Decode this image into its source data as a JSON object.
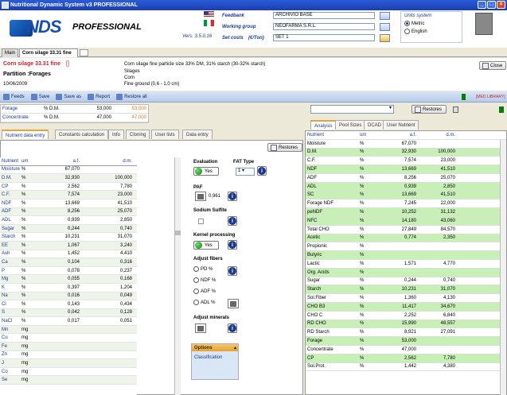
{
  "window": {
    "title": "Nutritional Dynamic System v3 PROFESSIONAL"
  },
  "header": {
    "logo_text": "NDS",
    "professional_label": "PROFESSIONAL",
    "version": "Vers. 3.5.0.16",
    "feedbank_label": "Feedbank",
    "feedbank_value": "ARCHIVIO BASE",
    "working_group_label": "Working group",
    "working_group_value": "NEOFARMA S.R.L.",
    "set_costs_label": "Set costs",
    "set_costs_unit": "(€/Ton)",
    "set_costs_value": "SET 1",
    "units_title": "Units system",
    "unit_metric": "Metric",
    "unit_english": "English",
    "selected_unit": "Metric"
  },
  "tabs": [
    {
      "label": "Main"
    },
    {
      "label": "Corn silage 33.31 fine",
      "active": true
    }
  ],
  "doc": {
    "title": "Corn silage 33.31 fine",
    "title_suffix": "[]",
    "partition": "Partition :Forages",
    "date": "10/06/2009",
    "desc1": "Corn silage fine particle size 33% DM, 31% starch (30-32% starch)",
    "desc2": "Silages",
    "desc3": "Corn",
    "desc4": "Fine ground (0,6 - 1,0 cm)",
    "close_label": "Close",
    "med_library": "[MED LIBRARY]"
  },
  "toolbar": {
    "feeds": "Feeds",
    "save": "Save",
    "save_as": "Save as",
    "report": "Report",
    "restore_all": "Restore all"
  },
  "forage_conc": [
    {
      "name": "Forage",
      "unit": "% D.M.",
      "v1": "53,000",
      "v2": "53,000"
    },
    {
      "name": "Concentrate",
      "unit": "% D.M.",
      "v1": "47,000",
      "v2": "47,000"
    }
  ],
  "left_tabs": [
    "Nutrient data entry",
    "Constants calculation",
    "Info",
    "Cloning",
    "User lists",
    "Data entry"
  ],
  "restores_label": "Restores",
  "nutrients_header": {
    "c1": "Nutrient",
    "c2": "um",
    "c3": "a.f.",
    "c4": "d.m."
  },
  "nutrients": [
    {
      "n": "Moisture",
      "u": "%",
      "a": "67,070",
      "d": ""
    },
    {
      "n": "D.M.",
      "u": "%",
      "a": "32,930",
      "d": "100,000"
    },
    {
      "n": "CP",
      "u": "%",
      "a": "2,562",
      "d": "7,780"
    },
    {
      "n": "C.F.",
      "u": "%",
      "a": "7,574",
      "d": "23,000"
    },
    {
      "n": "NDF",
      "u": "%",
      "a": "13,669",
      "d": "41,510"
    },
    {
      "n": "ADF",
      "u": "%",
      "a": "8,256",
      "d": "25,070"
    },
    {
      "n": "ADL",
      "u": "%",
      "a": "0,939",
      "d": "2,850"
    },
    {
      "n": "Sugar",
      "u": "%",
      "a": "0,244",
      "d": "0,740"
    },
    {
      "n": "Starch",
      "u": "%",
      "a": "10,231",
      "d": "31,070"
    },
    {
      "n": "EE",
      "u": "%",
      "a": "1,067",
      "d": "3,240"
    },
    {
      "n": "Ash",
      "u": "%",
      "a": "1,452",
      "d": "4,410"
    },
    {
      "n": "Ca",
      "u": "%",
      "a": "0,104",
      "d": "0,316"
    },
    {
      "n": "P",
      "u": "%",
      "a": "0,078",
      "d": "0,237"
    },
    {
      "n": "Mg",
      "u": "%",
      "a": "0,055",
      "d": "0,168"
    },
    {
      "n": "K",
      "u": "%",
      "a": "0,397",
      "d": "1,204"
    },
    {
      "n": "Na",
      "u": "%",
      "a": "0,016",
      "d": "0,049"
    },
    {
      "n": "Cl",
      "u": "%",
      "a": "0,143",
      "d": "0,434"
    },
    {
      "n": "S",
      "u": "%",
      "a": "0,042",
      "d": "0,128"
    },
    {
      "n": "NaCl",
      "u": "%",
      "a": "0,017",
      "d": "0,051"
    },
    {
      "n": "Mn",
      "u": "mg",
      "a": "",
      "d": ""
    },
    {
      "n": "Cu",
      "u": "mg",
      "a": "",
      "d": ""
    },
    {
      "n": "Fe",
      "u": "mg",
      "a": "",
      "d": ""
    },
    {
      "n": "Zn",
      "u": "mg",
      "a": "",
      "d": ""
    },
    {
      "n": "J",
      "u": "mg",
      "a": "",
      "d": ""
    },
    {
      "n": "Co",
      "u": "mg",
      "a": "",
      "d": ""
    },
    {
      "n": "Se",
      "u": "mg",
      "a": "",
      "d": ""
    }
  ],
  "controls": {
    "evaluation": "Evaluation",
    "evaluation_value": "Yes",
    "fat_type": "FAT Type",
    "fat_value": "1",
    "paf": "PAF",
    "paf_value": "0,961",
    "sodium_sulfite": "Sodium Sulfite",
    "kernel_processing": "Kernel processing",
    "kernel_value": "Yes",
    "adjust_fibers": "Adjust fibers",
    "fibers": [
      "PD %",
      "NDF %",
      "ADF %",
      "ADL %"
    ],
    "adjust_minerals": "Adjust minerals"
  },
  "options": {
    "title": "Options",
    "item": "Classification"
  },
  "right": {
    "restores_label": "Restores",
    "tabs": [
      "Analysis",
      "Pool Sizes",
      "DCAD",
      "User Nutrient"
    ],
    "header": {
      "n": "Nutrient",
      "u": "um",
      "a": "a.f.",
      "d": "d.m."
    },
    "rows": [
      {
        "n": "Moisture",
        "u": "%",
        "a": "67,070",
        "d": "",
        "g": false
      },
      {
        "n": "D.M.",
        "u": "%",
        "a": "32,930",
        "d": "100,000",
        "g": true
      },
      {
        "n": "C.F.",
        "u": "%",
        "a": "7,574",
        "d": "23,000",
        "g": false
      },
      {
        "n": "NDF",
        "u": "%",
        "a": "13,669",
        "d": "41,510",
        "g": true
      },
      {
        "n": "ADF",
        "u": "%",
        "a": "8,256",
        "d": "25,070",
        "g": false
      },
      {
        "n": "ADL",
        "u": "%",
        "a": "0,939",
        "d": "2,850",
        "g": true
      },
      {
        "n": "SC",
        "u": "%",
        "a": "13,669",
        "d": "41,510",
        "g": true
      },
      {
        "n": "Forage NDF",
        "u": "%",
        "a": "7,245",
        "d": "22,000",
        "g": false
      },
      {
        "n": "peNDF",
        "u": "%",
        "a": "10,252",
        "d": "31,132",
        "g": true
      },
      {
        "n": "NFC",
        "u": "%",
        "a": "14,180",
        "d": "43,060",
        "g": true
      },
      {
        "n": "Total CHO",
        "u": "%",
        "a": "27,849",
        "d": "84,570",
        "g": false
      },
      {
        "n": "Acetic",
        "u": "%",
        "a": "0,774",
        "d": "2,350",
        "g": true
      },
      {
        "n": "Propionic",
        "u": "%",
        "a": "",
        "d": "",
        "g": false
      },
      {
        "n": "Butyric",
        "u": "%",
        "a": "",
        "d": "",
        "g": true
      },
      {
        "n": "Lactic",
        "u": "%",
        "a": "1,571",
        "d": "4,770",
        "g": false
      },
      {
        "n": "Org. Acids",
        "u": "%",
        "a": "",
        "d": "",
        "g": true
      },
      {
        "n": "Sugar",
        "u": "%",
        "a": "0,244",
        "d": "0,740",
        "g": false
      },
      {
        "n": "Starch",
        "u": "%",
        "a": "10,231",
        "d": "31,070",
        "g": true
      },
      {
        "n": "Sol.Fiber",
        "u": "%",
        "a": "1,360",
        "d": "4,130",
        "g": false
      },
      {
        "n": "CHO B3",
        "u": "%",
        "a": "11,417",
        "d": "34,670",
        "g": true
      },
      {
        "n": "CHO C",
        "u": "%",
        "a": "2,252",
        "d": "6,840",
        "g": false
      },
      {
        "n": "RD CHO",
        "u": "%",
        "a": "15,990",
        "d": "48,557",
        "g": true
      },
      {
        "n": "RD Starch",
        "u": "%",
        "a": "8,921",
        "d": "27,091",
        "g": false
      },
      {
        "n": "Forage",
        "u": "%",
        "a": "53,000",
        "d": "",
        "g": true
      },
      {
        "n": "Concentrate",
        "u": "%",
        "a": "47,000",
        "d": "",
        "g": false
      },
      {
        "n": "CP",
        "u": "%",
        "a": "2,562",
        "d": "7,780",
        "g": true
      },
      {
        "n": "Sol.Prot.",
        "u": "%",
        "a": "1,442",
        "d": "4,380",
        "g": false
      }
    ]
  }
}
